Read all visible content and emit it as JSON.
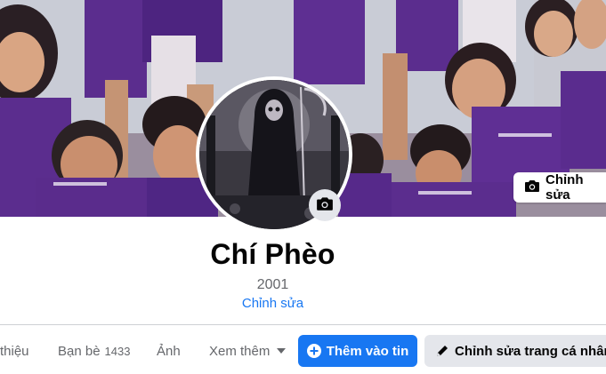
{
  "cover": {
    "edit_label": "Chỉnh sửa"
  },
  "profile": {
    "name": "Chí Phèo",
    "subtitle": "2001",
    "edit_link": "Chỉnh sửa"
  },
  "tabs": [
    {
      "label": "thiệu"
    },
    {
      "label": "Bạn bè",
      "count": "1433"
    },
    {
      "label": "Ảnh"
    },
    {
      "label": "Xem thêm"
    }
  ],
  "actions": {
    "add_story": "Thêm vào tin",
    "edit_profile": "Chỉnh sửa trang cá nhân"
  },
  "colors": {
    "accent": "#1877f2",
    "jersey": "#5b2d8e",
    "muted": "#65676b"
  },
  "icons": [
    "camera-icon",
    "plus-circle-icon",
    "pencil-icon",
    "caret-down-icon"
  ]
}
